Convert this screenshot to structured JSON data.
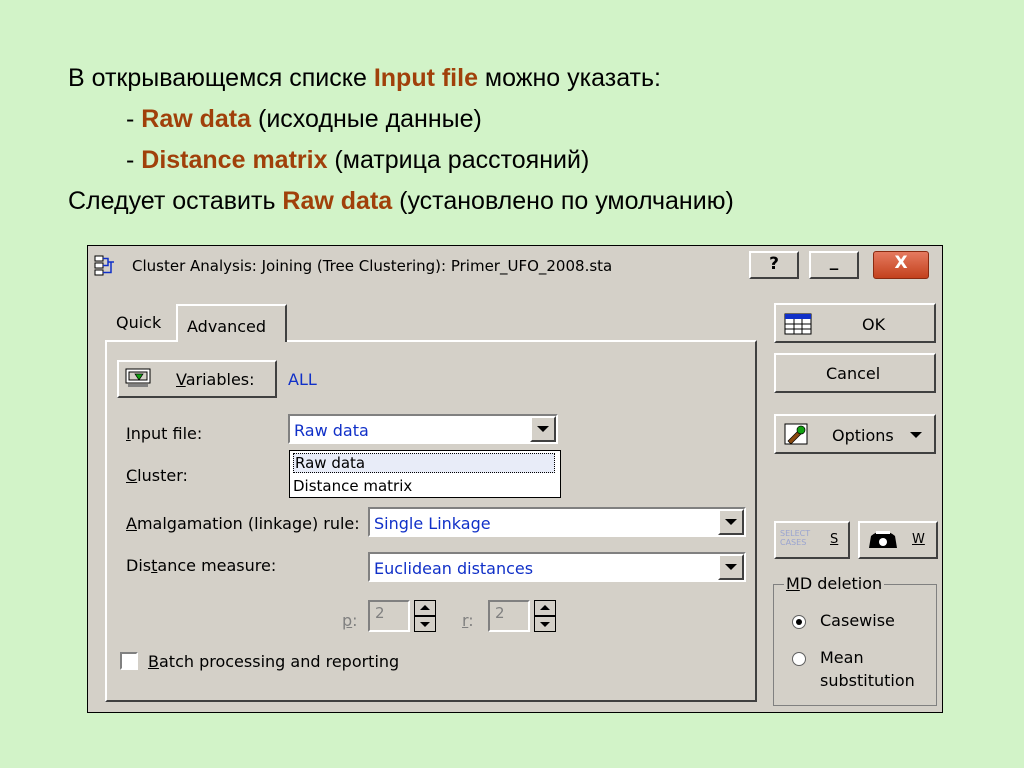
{
  "slide": {
    "line1": {
      "pre": "В открывающемся списке ",
      "hl": "Input file",
      "post": " можно указать:"
    },
    "line2": {
      "pre": "- ",
      "hl": "Raw data",
      "post": " (исходные данные)"
    },
    "line3": {
      "pre": "- ",
      "hl": "Distance matrix",
      "post": " (матрица расстояний)"
    },
    "line4": {
      "pre": "Следует оставить ",
      "hl": "Raw data",
      "post": " (установлено по умолчанию)"
    }
  },
  "dialog": {
    "title": "Cluster Analysis: Joining (Tree Clustering): Primer_UFO_2008.sta",
    "titlebar": {
      "help": "?",
      "minimize": "_",
      "close": "X"
    },
    "tabs": [
      "Quick",
      "Advanced"
    ],
    "variables_button": {
      "underlined": "V",
      "rest": "ariables:"
    },
    "variables_value": "ALL",
    "input_file": {
      "u": "I",
      "rest": "nput file:",
      "value": "Raw data",
      "options": [
        "Raw data",
        "Distance matrix"
      ]
    },
    "cluster": {
      "u": "C",
      "rest": "luster:"
    },
    "amalgamation": {
      "u": "A",
      "rest": "malgamation (linkage) rule:",
      "value": "Single Linkage"
    },
    "distance": {
      "pre": "Dis",
      "u": "t",
      "rest": "ance measure:",
      "value": "Euclidean distances"
    },
    "p": {
      "u": "p",
      "rest": ":",
      "value": "2"
    },
    "r": {
      "u": "r",
      "rest": ":",
      "value": "2"
    },
    "batch": {
      "u": "B",
      "rest": "atch processing and reporting",
      "checked": false
    },
    "ok": "OK",
    "cancel": "Cancel",
    "options": "Options",
    "s_button": "S",
    "w_button": "W",
    "select_cases_icon_text": "SELECT CASES",
    "md_deletion": {
      "u": "M",
      "rest": "D deletion",
      "casewise": "Casewise",
      "mean_line1": "Mean",
      "mean_line2": "substitution",
      "selected": "Casewise"
    }
  },
  "colors": {
    "background": "#d2f3c8",
    "highlight": "#a0400a",
    "dialog": "#d4d0c8",
    "value_blue": "#1030c8"
  }
}
